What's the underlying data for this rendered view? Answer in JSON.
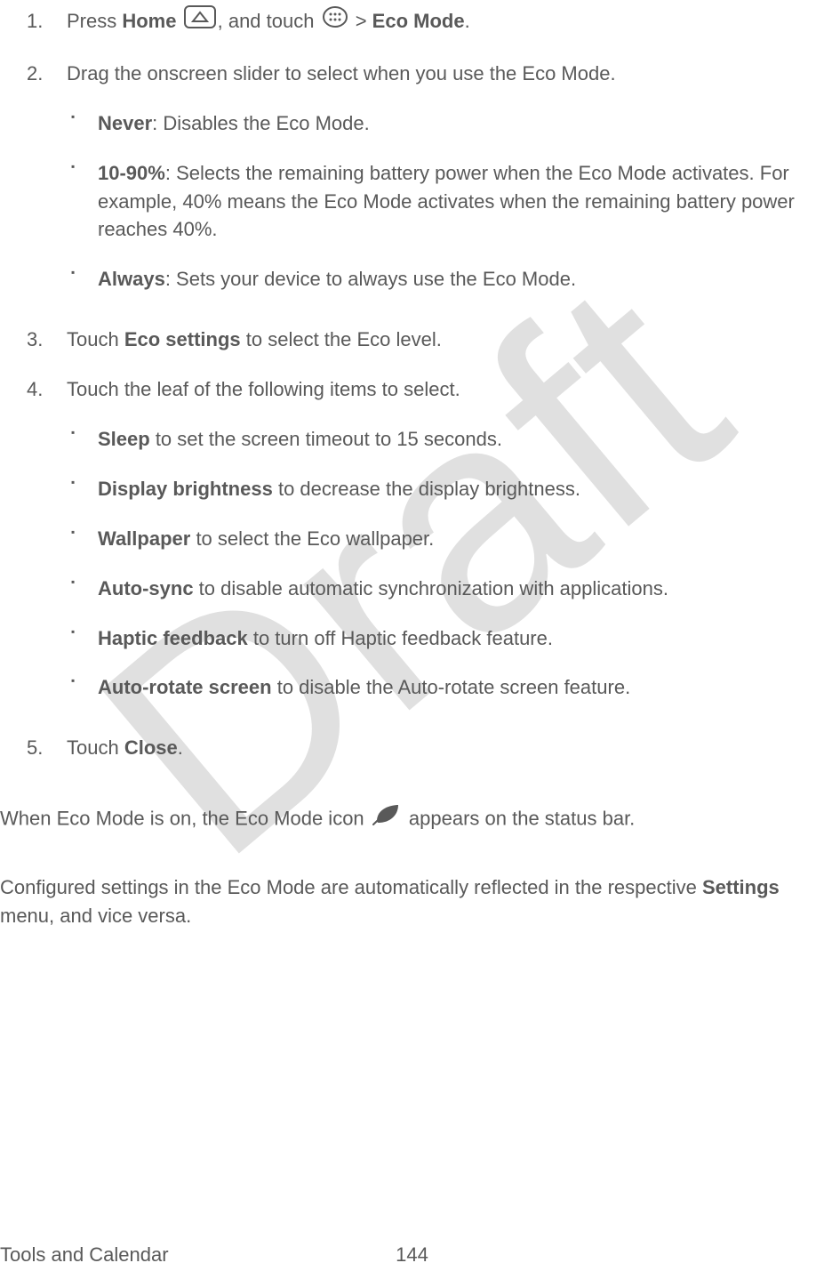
{
  "watermark": "Draft",
  "steps": [
    {
      "num": "1.",
      "parts": [
        "Press ",
        "Home",
        " ",
        "HOME_ICON",
        ", and touch ",
        "APPS_ICON",
        " > ",
        "Eco Mode",
        "."
      ]
    },
    {
      "num": "2.",
      "text": "Drag the onscreen slider to select when you use the Eco Mode.",
      "sub": [
        {
          "bold": "Never",
          "rest": ": Disables the Eco Mode."
        },
        {
          "bold": "10-90%",
          "rest": ": Selects the remaining battery power when the Eco Mode activates. For example, 40% means the Eco Mode activates when the remaining battery power reaches 40%."
        },
        {
          "bold": "Always",
          "rest": ": Sets your device to always use the Eco Mode."
        }
      ]
    },
    {
      "num": "3.",
      "parts": [
        "Touch ",
        "Eco settings",
        " to select the Eco level."
      ]
    },
    {
      "num": "4.",
      "text": "Touch the leaf of the following items to select.",
      "sub": [
        {
          "bold": "Sleep",
          "rest": " to set the screen timeout to 15 seconds."
        },
        {
          "bold": "Display brightness",
          "rest": " to decrease the display brightness."
        },
        {
          "bold": "Wallpaper",
          "rest": " to select the Eco wallpaper."
        },
        {
          "bold": "Auto-sync",
          "rest": " to disable automatic synchronization with applications."
        },
        {
          "bold": "Haptic feedback",
          "rest": " to turn off Haptic feedback feature."
        },
        {
          "bold": "Auto-rotate screen",
          "rest": " to disable the Auto-rotate screen feature."
        }
      ]
    },
    {
      "num": "5.",
      "parts": [
        "Touch ",
        "Close",
        "."
      ]
    }
  ],
  "after": {
    "p1_a": "When Eco Mode is on, the Eco Mode icon ",
    "p1_b": " appears on the status bar.",
    "p2_a": "Configured settings in the Eco Mode are automatically reflected in the respective ",
    "p2_bold": "Settings",
    "p2_b": " menu, and vice versa."
  },
  "footer": {
    "section": "Tools and Calendar",
    "page": "144"
  }
}
